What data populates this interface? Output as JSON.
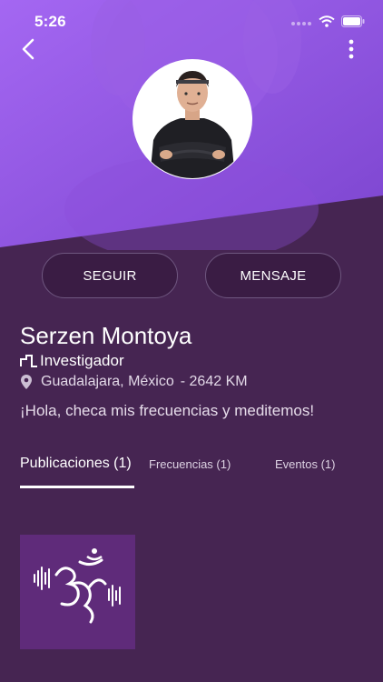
{
  "status_bar": {
    "time": "5:26"
  },
  "header": {
    "back_icon": "chevron-left-icon",
    "menu_icon": "more-vertical-icon"
  },
  "profile": {
    "name": "Serzen Montoya",
    "role": "Investigador",
    "location": "Guadalajara, México",
    "distance": "- 2642 KM",
    "bio": "¡Hola, checa mis frecuencias y meditemos!"
  },
  "actions": {
    "follow_label": "SEGUIR",
    "message_label": "MENSAJE"
  },
  "tabs": [
    {
      "label": "Publicaciones (1)",
      "active": true
    },
    {
      "label": "Frecuencias (1)",
      "active": false
    },
    {
      "label": "Eventos (1)",
      "active": false
    }
  ],
  "posts": [
    {
      "icon": "om-sound-wave-icon"
    }
  ],
  "colors": {
    "header_purple": "#8a4fd8",
    "background": "#462552",
    "button_bg": "#3a1c44",
    "post_bg": "#5f2b7a"
  }
}
